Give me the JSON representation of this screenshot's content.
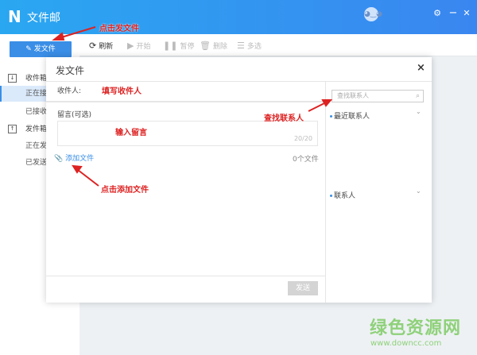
{
  "app": {
    "title": "文件邮",
    "logo": "N"
  },
  "header": {
    "avatar_icon": "avatar-face-icon",
    "settings_icon": "⚙",
    "minimize_icon": "−",
    "close_icon": "✕"
  },
  "sidebar": {
    "send_button": "发文件",
    "groups": [
      {
        "label": "收件箱",
        "items": [
          "正在接收",
          "已接收"
        ]
      },
      {
        "label": "发件箱",
        "items": [
          "正在发送",
          "已发送"
        ]
      }
    ]
  },
  "toolbar": {
    "refresh": "刷新",
    "start": "开始",
    "pause": "暂停",
    "delete": "删除",
    "multi": "多选"
  },
  "dialog": {
    "title": "发文件",
    "close": "×",
    "recipient_label": "收件人:",
    "message_label": "留言(可选)",
    "message_counter": "20/20",
    "add_file": "添加文件",
    "file_count": "0个文件",
    "send": "发送",
    "search_placeholder": "查找联系人",
    "recent_contacts": "最近联系人",
    "contacts": "联系人"
  },
  "annotations": {
    "click_send": "点击发文件",
    "fill_recipient": "填写收件人",
    "input_message": "输入留言",
    "find_contact": "查找联系人",
    "click_add_file": "点击添加文件"
  },
  "watermark": {
    "name": "绿色资源网",
    "url": "www.downcc.com"
  },
  "colors": {
    "header_start": "#2aa7f1",
    "header_end": "#3a86f0",
    "accent": "#3a8ee6",
    "annotation": "#dd2222",
    "watermark": "#8fd17a"
  }
}
